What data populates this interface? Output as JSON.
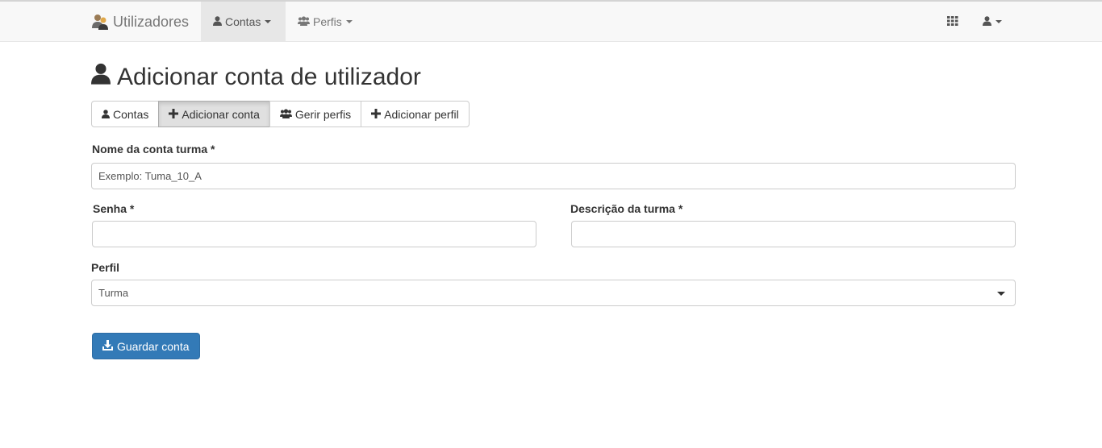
{
  "navbar": {
    "brand": "Utilizadores",
    "items": [
      {
        "label": "Contas",
        "active": true
      },
      {
        "label": "Perfis",
        "active": false
      }
    ]
  },
  "page": {
    "title": "Adicionar conta de utilizador"
  },
  "tabs": [
    {
      "label": "Contas",
      "icon": "user-icon"
    },
    {
      "label": "Adicionar conta",
      "icon": "plus-icon",
      "active": true
    },
    {
      "label": "Gerir perfis",
      "icon": "users-icon"
    },
    {
      "label": "Adicionar perfil",
      "icon": "plus-icon"
    }
  ],
  "form": {
    "account_name_label": "Nome da conta turma *",
    "account_name_placeholder": "Exemplo: Tuma_10_A",
    "password_label": "Senha *",
    "description_label": "Descrição da turma *",
    "profile_label": "Perfil",
    "profile_selected": "Turma",
    "save_label": "Guardar conta"
  },
  "colors": {
    "primary": "#337ab7",
    "navbar_bg": "#f8f8f8"
  }
}
